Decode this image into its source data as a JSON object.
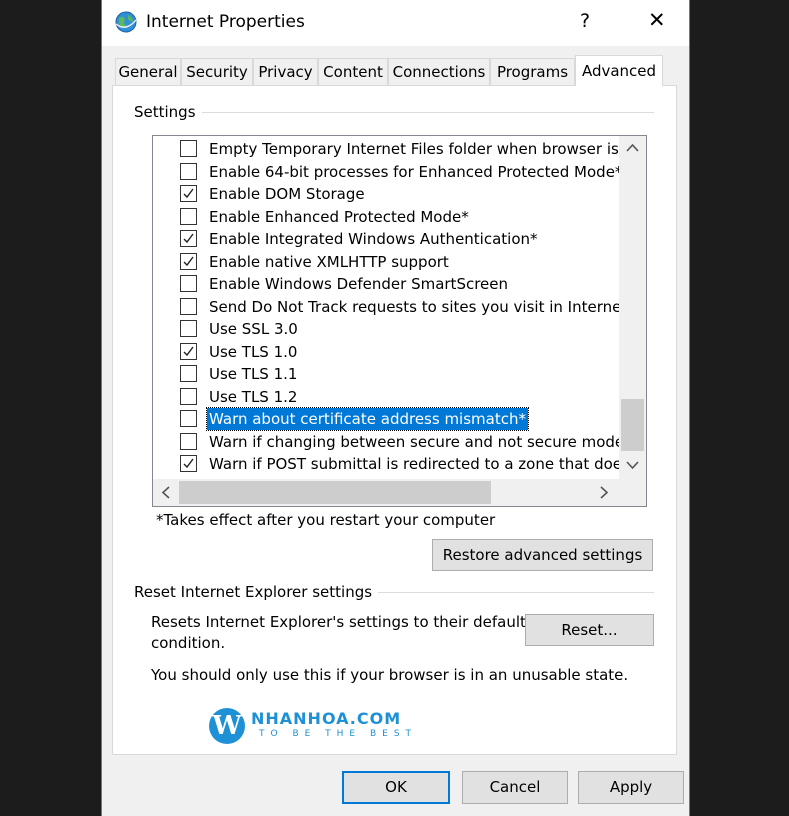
{
  "window": {
    "title": "Internet Properties",
    "help": "?",
    "close": "✕"
  },
  "tabs": [
    {
      "label": "General"
    },
    {
      "label": "Security"
    },
    {
      "label": "Privacy"
    },
    {
      "label": "Content"
    },
    {
      "label": "Connections"
    },
    {
      "label": "Programs"
    },
    {
      "label": "Advanced",
      "selected": true
    }
  ],
  "settings": {
    "label": "Settings",
    "items": [
      {
        "label": "Empty Temporary Internet Files folder when browser is cl",
        "checked": false
      },
      {
        "label": "Enable 64-bit processes for Enhanced Protected Mode*",
        "checked": false
      },
      {
        "label": "Enable DOM Storage",
        "checked": true
      },
      {
        "label": "Enable Enhanced Protected Mode*",
        "checked": false
      },
      {
        "label": "Enable Integrated Windows Authentication*",
        "checked": true
      },
      {
        "label": "Enable native XMLHTTP support",
        "checked": true
      },
      {
        "label": "Enable Windows Defender SmartScreen",
        "checked": false
      },
      {
        "label": "Send Do Not Track requests to sites you visit in Internet E",
        "checked": false
      },
      {
        "label": "Use SSL 3.0",
        "checked": false
      },
      {
        "label": "Use TLS 1.0",
        "checked": true
      },
      {
        "label": "Use TLS 1.1",
        "checked": false
      },
      {
        "label": "Use TLS 1.2",
        "checked": false
      },
      {
        "label": "Warn about certificate address mismatch*",
        "checked": false,
        "selected": true
      },
      {
        "label": "Warn if changing between secure and not secure mode",
        "checked": false
      },
      {
        "label": "Warn if POST submittal is redirected to a zone that does r",
        "checked": true
      }
    ],
    "note": "*Takes effect after you restart your computer",
    "restore_label": "Restore advanced settings"
  },
  "reset": {
    "label": "Reset Internet Explorer settings",
    "description_line1": "Resets Internet Explorer's settings to their default",
    "description_line2": "condition.",
    "button_label": "Reset...",
    "warning": "You should only use this if your browser is in an unusable state."
  },
  "logo": {
    "letter": "W",
    "name": "NHANHOA.COM",
    "tagline": "TO BE THE BEST"
  },
  "footer": {
    "ok_label": "OK",
    "cancel_label": "Cancel",
    "apply_label": "Apply"
  },
  "colors": {
    "selection": "#0078d7",
    "logo": "#1e90d6"
  }
}
